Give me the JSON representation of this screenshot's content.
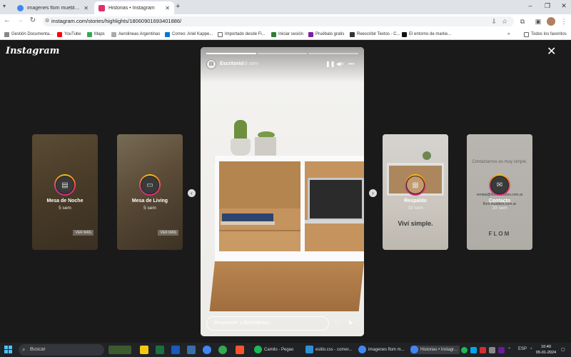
{
  "browser": {
    "tabs": [
      {
        "title": "imagenes flom muebles - Busca",
        "active": false,
        "favicon_color": "#4285f4"
      },
      {
        "title": "Historias • Instagram",
        "active": true,
        "favicon_color": "#e1306c"
      }
    ],
    "new_tab": "+",
    "url": "instagram.com/stories/highlights/18060901693401886/",
    "bookmarks": [
      "Gestión Documenta...",
      "YouTube",
      "Maps",
      "Aerolineas Argentinas",
      "Correo: Ariel Kappe...",
      "Importado desde Fi...",
      "Iniciar sesión",
      "Pruébalo gratis",
      "Reescribir Textos - C...",
      "El entorno de marke..."
    ],
    "bookmarks_more": "»",
    "all_bookmarks": "Todos los favoritos"
  },
  "viewer": {
    "logo": "Instagram",
    "close": "✕",
    "highlights": [
      {
        "name": "Mesa de Noche",
        "ago": "5 sem",
        "vermas": "VER MÁS"
      },
      {
        "name": "Mesa de Living",
        "ago": "5 sem",
        "vermas": "VER MÁS"
      },
      {
        "name": "Respaldo",
        "ago": "33 sem",
        "overlay": "Viví simple."
      },
      {
        "name": "Contacto",
        "ago": "29 sem",
        "top_text": "Contactarnos es muy simple.",
        "email1": "ventas@flommuebles.com.ar",
        "email2": "flom.muebles.com.ar",
        "logo": "FLOM"
      }
    ],
    "story": {
      "user": "Escritorio",
      "ago": "33 sem",
      "reply_placeholder": "Responder a flomfabrica...",
      "progress_done": 1,
      "progress_total": 3
    }
  },
  "taskbar": {
    "search": "Buscar",
    "apps": [
      {
        "label": "Camilo - Pegao",
        "color": "#1db954"
      },
      {
        "label": "estilo.css - comer...",
        "color": "#2d8fd5"
      },
      {
        "label": "imagenes flom m...",
        "color": "#4285f4"
      },
      {
        "label": "Historias • Instagr...",
        "color": "#4285f4"
      }
    ],
    "lang": "ESP",
    "time": "10:40",
    "date": "05-01-2024"
  }
}
